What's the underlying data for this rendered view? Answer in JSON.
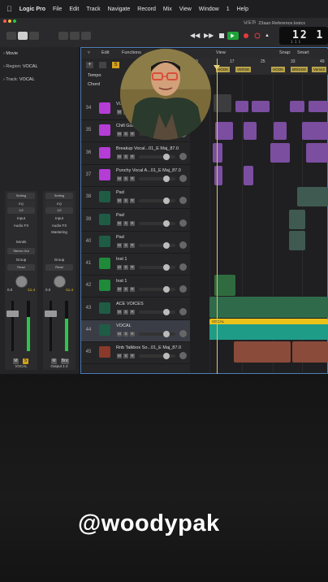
{
  "menubar": {
    "items": [
      "Logic Pro",
      "File",
      "Edit",
      "Track",
      "Navigate",
      "Record",
      "Mix",
      "View",
      "Window",
      "1",
      "Help"
    ]
  },
  "document_title": "남두한_23aan Reference.logicx",
  "lcd": {
    "position": "12 1",
    "sub": "1 1 1"
  },
  "inspector": {
    "movie_label": "Movie",
    "region_label": "Region:",
    "region_value": "VOCAL",
    "track_label": "Track:",
    "track_value": "VOCAL",
    "strips": [
      {
        "setting": "Setting",
        "eq": "EQ",
        "input": "1/2",
        "input2": "Input",
        "fx": "Audio FX",
        "sends": "Sends",
        "output": "Stereo Out",
        "group": "Group",
        "automation": "Read",
        "vol": "0.0",
        "peak": "-11.4",
        "m": "M",
        "s": "S",
        "name": "VOCAL"
      },
      {
        "setting": "Setting",
        "eq": "EQ",
        "input": "1/2",
        "input2": "Input",
        "fx": "Audio FX",
        "sends": "Mastering",
        "output": "",
        "group": "Group",
        "automation": "Read",
        "vol": "0.0",
        "peak": "-11.4",
        "m": "M",
        "s": "Bnc",
        "name": "Output 1-2"
      }
    ]
  },
  "tracks_toolbar": {
    "edit": "Edit",
    "functions": "Functions",
    "view": "View",
    "snap_label": "Snap:",
    "snap_value": "Smart"
  },
  "global_tracks": {
    "tempo": "Tempo",
    "chord": "Chord"
  },
  "ruler": {
    "bars": [
      "9",
      "17",
      "25",
      "33",
      "49"
    ],
    "markers": [
      "HOOK",
      "VERSE",
      "HOOK",
      "BRIDGE",
      "Verse2"
    ]
  },
  "tracks": [
    {
      "num": "34",
      "name": "Vi...",
      "color": "#b43dd6"
    },
    {
      "num": "35",
      "name": "Chill Gui...",
      "color": "#b43dd6"
    },
    {
      "num": "36",
      "name": "Breakup Vocal...01_E Maj_87.0",
      "color": "#b43dd6"
    },
    {
      "num": "37",
      "name": "Punchy Vocal A...01_E Maj_87.0",
      "color": "#b43dd6"
    },
    {
      "num": "38",
      "name": "Pad",
      "color": "#1e5c45"
    },
    {
      "num": "39",
      "name": "Pad",
      "color": "#1e5c45"
    },
    {
      "num": "40",
      "name": "Pad",
      "color": "#1e5c45"
    },
    {
      "num": "41",
      "name": "Inst 1",
      "color": "#1f8a3a"
    },
    {
      "num": "42",
      "name": "Inst 1",
      "color": "#1f8a3a"
    },
    {
      "num": "43",
      "name": "ACE VOICES",
      "color": "#1e5c45"
    },
    {
      "num": "44",
      "name": "VOCAL",
      "color": "#1e5c45"
    },
    {
      "num": "45",
      "name": "Rnb Talkbox So...01_E Maj_87.0",
      "color": "#8a3a2a"
    }
  ],
  "region_labels": {
    "vocal": "VOCAL"
  },
  "overlay": {
    "handle": "@woodypak"
  },
  "colors": {
    "accent_green": "#29c84a",
    "selection_blue": "#4e7db7",
    "vocal_region": "#e9c21a",
    "playhead": "#d7c86a"
  }
}
